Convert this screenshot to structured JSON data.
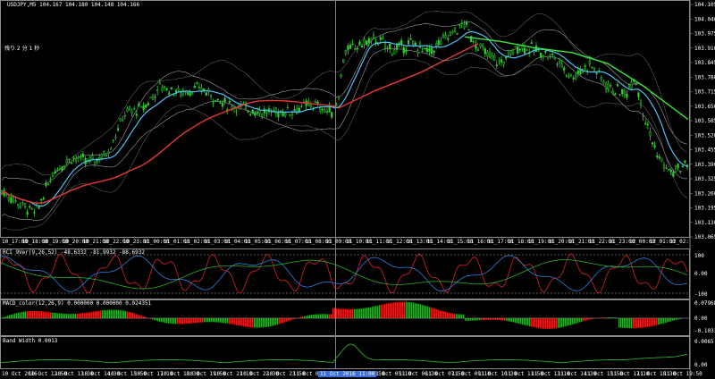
{
  "header": {
    "symbol_line": "USDJPY,M5  104.167 104.180 104.148 104.166",
    "countdown": "残り 2 分 1 秒"
  },
  "price_axis": [
    "104.105",
    "104.040",
    "103.975",
    "103.910",
    "103.845",
    "103.780",
    "103.715",
    "103.650",
    "103.585",
    "103.520",
    "103.455",
    "103.390",
    "103.325",
    "103.260",
    "103.195",
    "103.130",
    "103.065"
  ],
  "time_axis_main": [
    "10_17:00",
    "10_18:00",
    "10_19:00",
    "10_20:00",
    "10_21:00",
    "10_22:00",
    "10_23:00",
    "11_00:00",
    "11_01:00",
    "11_02:00",
    "11_03:00",
    "11_04:00",
    "11_05:00",
    "11_06:00",
    "11_07:00",
    "11_08:00",
    "11_09:00",
    "11_10:00",
    "11_11:00",
    "11_12:00",
    "11_13:00",
    "11_14:00",
    "11_15:00",
    "11_16:00",
    "11_17:00",
    "11_18:00",
    "11_19:00",
    "11_20:00",
    "11_21:00",
    "11_22:00",
    "11_23:00",
    "12_00:00",
    "12_01:00",
    "12_02:"
  ],
  "stoch_panel": {
    "label": "RCI 9Ver(9,26,52) -48.6332 -81.9932 -88.6932",
    "axis": [
      "100",
      "0.00",
      "-100"
    ]
  },
  "macd_panel": {
    "label": "MACD_color(12,26,9) 0.000000 0.000000 0.024351",
    "axis": [
      "0.079685",
      "0.00",
      "-0.103114"
    ]
  },
  "bw_panel": {
    "label": "Band Width 0.0013",
    "axis": [
      "0.0065",
      "0.00"
    ]
  },
  "time_axis_bottom": [
    "10 Oct 2016",
    "10 Oct 12:50",
    "10 Oct 13:30",
    "10 Oct 14:30",
    "10 Oct 15:50",
    "10 Oct 17:10",
    "10 Oct 18:30",
    "10 Oct 19:50",
    "10 Oct 21:10",
    "10 Oct 22:30",
    "10 Oct 23:50",
    "11 Oct 01:10",
    "11 Oct 02:30",
    "11 Oct 03:50",
    "11 Oct 05:10",
    "11 Oct 06:30",
    "11 Oct 07:50",
    "11 Oct 09:10",
    "11 Oct 10:30",
    "11 Oct 11:50",
    "11 Oct 13:10",
    "11 Oct 14:30",
    "11 Oct 15:50",
    "11 Oct 17:10",
    "11 Oct 18:30",
    "11 Oct 19:50"
  ],
  "crosshair_time": "11 Oct 2016 11:00",
  "colors": {
    "background": "#000000",
    "candle": "#32cd32",
    "ma_fast": "#4fc3f7",
    "ma_mid": "#e53935",
    "ma_slow": "#39e639",
    "bands": "#9e9e9e",
    "crosshair": "#4a8fd8",
    "macd_up": "#2ea82e",
    "macd_down": "#e02020",
    "rci_red": "#d9232d",
    "rci_blue": "#2f7fd8",
    "rci_green": "#2ea82e"
  }
}
